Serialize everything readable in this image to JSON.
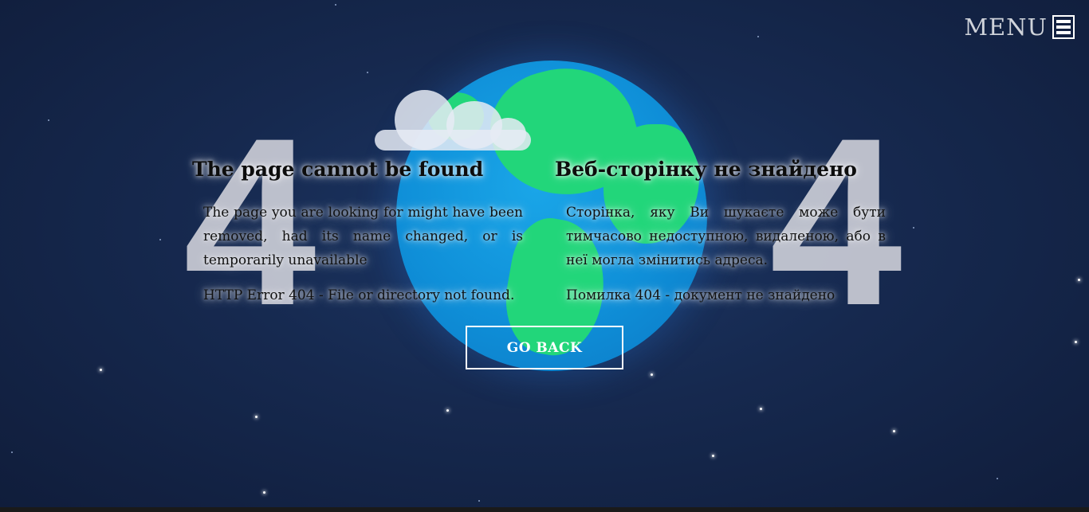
{
  "menu": {
    "label": "MENU"
  },
  "background": {
    "digit_left": "4",
    "digit_right": "4"
  },
  "english": {
    "title": "The page cannot be found",
    "message": "The page you are looking for might have been removed, had its name changed, or is temporarily unavailable",
    "error": "HTTP Error 404 - File or directory not found."
  },
  "ukrainian": {
    "title": "Веб-сторінку не знайдено",
    "message": "Сторінка, яку Ви шукаєте може бути тимчасово недоступною, видаленою, або в неї могла змінитись адреса.",
    "error": "Помилка 404 - документ не знайдено"
  },
  "actions": {
    "go_back_label": "GO BACK"
  },
  "colors": {
    "background": "#16294f",
    "globe_ocean": "#0f8fd8",
    "globe_land": "#22d67a",
    "button_border": "#ffffff"
  }
}
